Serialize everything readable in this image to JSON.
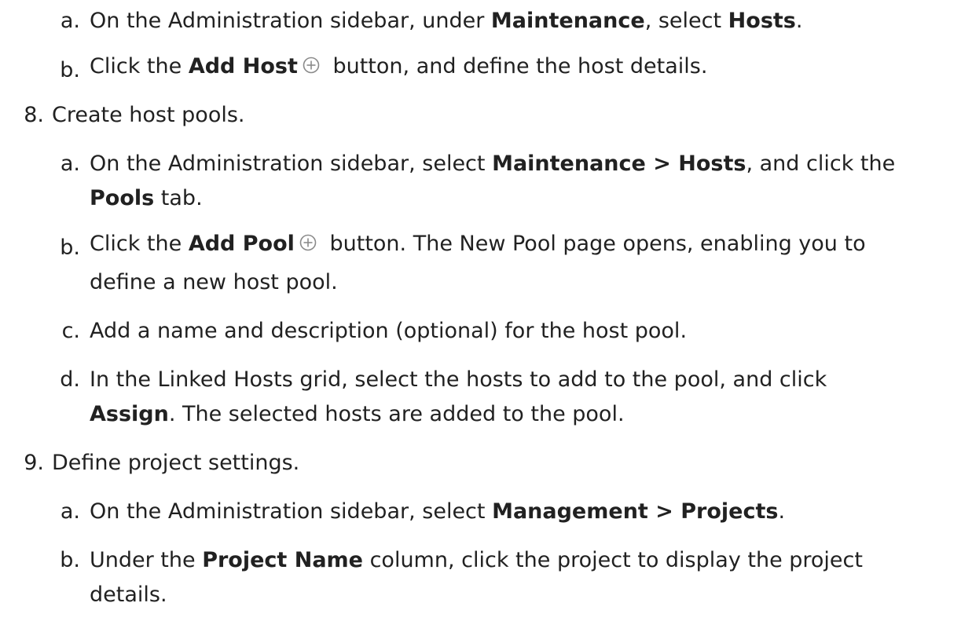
{
  "steps": {
    "s7a": {
      "marker": "a.",
      "t1": "On the Administration sidebar, under ",
      "b1": "Maintenance",
      "t2": ", select ",
      "b2": "Hosts",
      "t3": "."
    },
    "s7b": {
      "marker": "b.",
      "t1": "Click the ",
      "b1": "Add Host",
      "icon": "add-circle-icon",
      "t2": " button, and define the host details."
    },
    "s8": {
      "marker": "8.",
      "text": "Create host pools.",
      "a": {
        "marker": "a.",
        "t1": "On the Administration sidebar, select ",
        "b1": "Maintenance > Hosts",
        "t2": ", and click the",
        "b2": "Pools",
        "t3": " tab."
      },
      "b": {
        "marker": "b.",
        "t1": "Click the ",
        "b1": "Add Pool",
        "icon": "add-circle-icon",
        "t2": " button. The New Pool page opens, enabling you to",
        "t3": "define a new host pool."
      },
      "c": {
        "marker": "c.",
        "text": "Add a name and description (optional) for the host pool."
      },
      "d": {
        "marker": "d.",
        "t1": "In the Linked Hosts grid, select the hosts to add to the pool, and click",
        "b1": "Assign",
        "t2": ". The selected hosts are added to the pool."
      }
    },
    "s9": {
      "marker": "9.",
      "text": "Define project settings.",
      "a": {
        "marker": "a.",
        "t1": "On the Administration sidebar, select ",
        "b1": "Management > Projects",
        "t2": "."
      },
      "b": {
        "marker": "b.",
        "t1": "Under the ",
        "b1": "Project Name",
        "t2": " column, click the project to display the project",
        "t3": "details."
      }
    }
  },
  "colors": {
    "text": "#212121",
    "icon": "#8a8a8a"
  }
}
